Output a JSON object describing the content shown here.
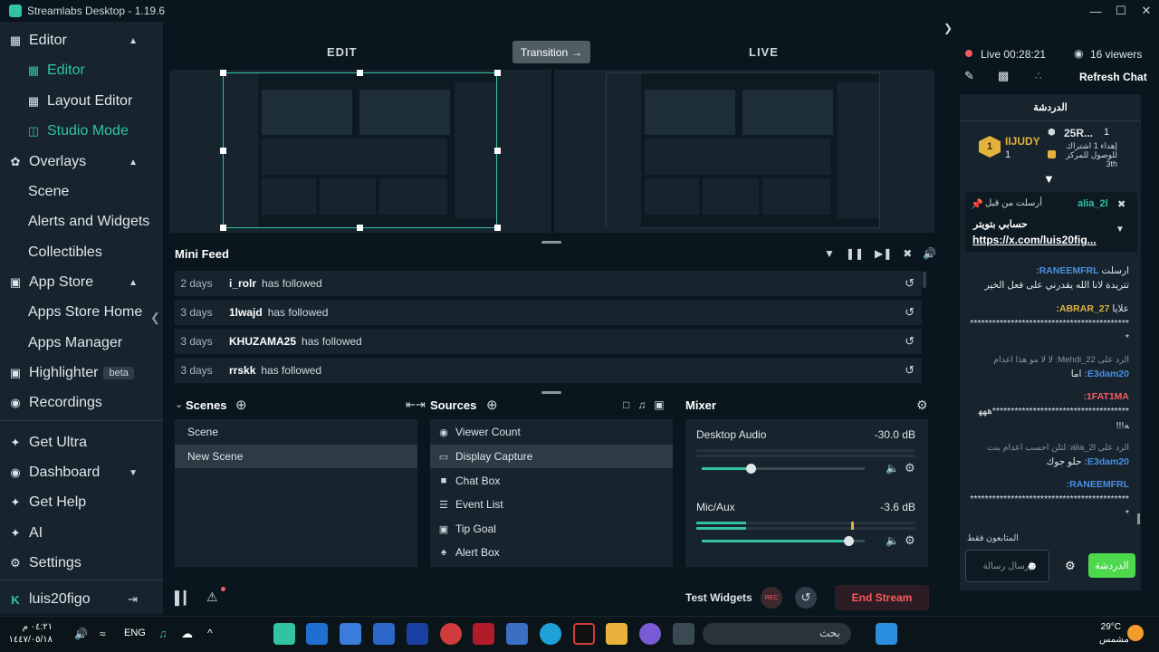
{
  "window": {
    "title": "Streamlabs Desktop - 1.19.6"
  },
  "sidebar": {
    "items": [
      {
        "label": "Editor",
        "icon": "editor-icon"
      },
      {
        "label": "Editor",
        "icon": "editor-icon"
      },
      {
        "label": "Layout Editor",
        "icon": "layout-icon"
      },
      {
        "label": "Studio Mode",
        "icon": "studio-mode-icon"
      },
      {
        "label": "Overlays",
        "icon": "overlays-icon"
      },
      {
        "label": "Scene"
      },
      {
        "label": "Alerts and Widgets"
      },
      {
        "label": "Collectibles"
      },
      {
        "label": "App Store",
        "icon": "store-icon"
      },
      {
        "label": "Apps Store Home"
      },
      {
        "label": "Apps Manager"
      },
      {
        "label": "Highlighter",
        "icon": "highlighter-icon",
        "badge": "beta"
      },
      {
        "label": "Recordings",
        "icon": "recordings-icon"
      },
      {
        "label": "Get Ultra",
        "icon": "ultra-icon"
      },
      {
        "label": "Dashboard",
        "icon": "dashboard-icon"
      },
      {
        "label": "Get Help",
        "icon": "help-icon"
      },
      {
        "label": "AI",
        "icon": "ai-icon"
      },
      {
        "label": "Settings",
        "icon": "settings-icon"
      }
    ],
    "user": "luis20figo"
  },
  "studio": {
    "edit_label": "EDIT",
    "live_label": "LIVE",
    "transition_label": "Transition"
  },
  "minifeed": {
    "title": "Mini Feed",
    "rows": [
      {
        "ago": "2 days",
        "user": "i_rolr",
        "action": "has followed"
      },
      {
        "ago": "3 days",
        "user": "1lwajd",
        "action": "has followed"
      },
      {
        "ago": "3 days",
        "user": "KHUZAMA25",
        "action": "has followed"
      },
      {
        "ago": "3 days",
        "user": "rrskk",
        "action": "has followed"
      }
    ]
  },
  "scenes": {
    "title": "Scenes",
    "items": [
      "Scene",
      "New Scene"
    ]
  },
  "sources": {
    "title": "Sources",
    "items": [
      "Viewer Count",
      "Display Capture",
      "Chat Box",
      "Event List",
      "Tip Goal",
      "Alert Box"
    ]
  },
  "mixer": {
    "title": "Mixer",
    "channels": [
      {
        "name": "Desktop Audio",
        "db": "-30.0 dB",
        "level": 0.3
      },
      {
        "name": "Mic/Aux",
        "db": "-3.6 dB",
        "level": 0.9
      }
    ]
  },
  "bottom": {
    "test_widgets": "Test Widgets",
    "end_stream": "End Stream"
  },
  "live": {
    "timer": "Live 00:28:21",
    "viewers": "16 viewers",
    "refresh": "Refresh Chat"
  },
  "chat": {
    "header": "الدردشة",
    "leader_user": "IIJUDY",
    "leader_rank": "1",
    "leader_count": "1",
    "side_top": "25R...",
    "side_one": "1",
    "side_text1": "إهداء 1 اشتراك",
    "side_text2": "للوصول للمركز",
    "side_text3": "3th",
    "pinned_user": "alia_2l",
    "pinned_meta": "أرسلت من قبل",
    "pinned_text": "حسابي بتويتر",
    "pinned_link": "https://x.com/luis20fig...",
    "messages": [
      {
        "name": "RANEEMFRL:",
        "prefix": "ارسلت",
        "text": "تتريدة لانا الله يقدرني على فعل الخير"
      },
      {
        "name": "ABRAR_27:",
        "prefix": "علايا",
        "text": "********************************************"
      },
      {
        "name": "E3dam20:",
        "reply": "الرد على Mehdi_22: لا لا مو هذا اعدام",
        "text": "اما"
      },
      {
        "name": "1FAT1MA:",
        "text": "*************************************هههه!!!"
      },
      {
        "name": "E3dam20:",
        "reply": "الرد على alia_2l: لتلن احسب اعدام بنت",
        "text": "حلو جوك"
      },
      {
        "name": "RANEEMFRL:",
        "text": "********************************************"
      }
    ],
    "followers_only": "المتابعون فقط",
    "input_placeholder": "إرسال رسالة",
    "send": "الدردشة"
  },
  "taskbar": {
    "time": "٠٤:٢١ م",
    "date": "١٤٤٧/٠٥/١٨",
    "lang": "ENG",
    "search": "بحث",
    "weather": "29°C",
    "weather_desc": "مشمس"
  },
  "colors": {
    "accent": "#31c3a2",
    "danger": "#f85961",
    "panel": "#17242d",
    "bg": "#09161d"
  }
}
